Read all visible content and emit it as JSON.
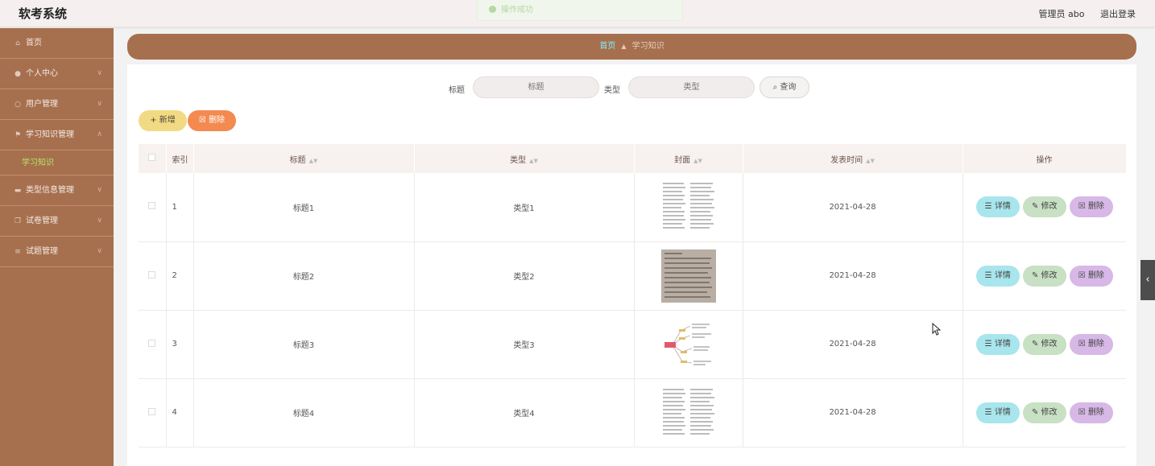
{
  "app": {
    "title": "软考系统"
  },
  "toast": {
    "text": "操作成功"
  },
  "header": {
    "user": "管理员 abo",
    "logout": "退出登录"
  },
  "sidebar": {
    "items": [
      {
        "label": "首页",
        "icon": "home-icon",
        "chevron": false
      },
      {
        "label": "个人中心",
        "icon": "user-icon",
        "chevron": true
      },
      {
        "label": "用户管理",
        "icon": "users-icon",
        "chevron": true
      },
      {
        "label": "学习知识管理",
        "icon": "flag-icon",
        "chevron": true
      },
      {
        "label": "类型信息管理",
        "icon": "monitor-icon",
        "chevron": true
      },
      {
        "label": "试卷管理",
        "icon": "copy-icon",
        "chevron": true
      },
      {
        "label": "试题管理",
        "icon": "list-icon",
        "chevron": true
      }
    ],
    "submenu_label": "学习知识"
  },
  "breadcrumb": {
    "home": "首页",
    "current": "学习知识"
  },
  "search": {
    "title_label": "标题",
    "title_placeholder": "标题",
    "type_label": "类型",
    "type_placeholder": "类型",
    "query_button": "查询"
  },
  "toolbar": {
    "add_label": "新增",
    "delete_label": "删除"
  },
  "table": {
    "headers": [
      "索引",
      "标题",
      "类型",
      "封面",
      "发表时间",
      "操作"
    ],
    "rows": [
      {
        "index": "1",
        "title": "标题1",
        "type": "类型1",
        "cover": "text-page",
        "date": "2021-04-28"
      },
      {
        "index": "2",
        "title": "标题2",
        "type": "类型2",
        "cover": "photo-page",
        "date": "2021-04-28"
      },
      {
        "index": "3",
        "title": "标题3",
        "type": "类型3",
        "cover": "mindmap",
        "date": "2021-04-28"
      },
      {
        "index": "4",
        "title": "标题4",
        "type": "类型4",
        "cover": "text-page",
        "date": "2021-04-28"
      }
    ],
    "actions": {
      "detail": "详情",
      "edit": "修改",
      "delete": "删除"
    }
  },
  "colors": {
    "sidebar": "#a6704f",
    "accent_green": "#b9e25f",
    "breadcrumb_home": "#7ff0ff"
  }
}
